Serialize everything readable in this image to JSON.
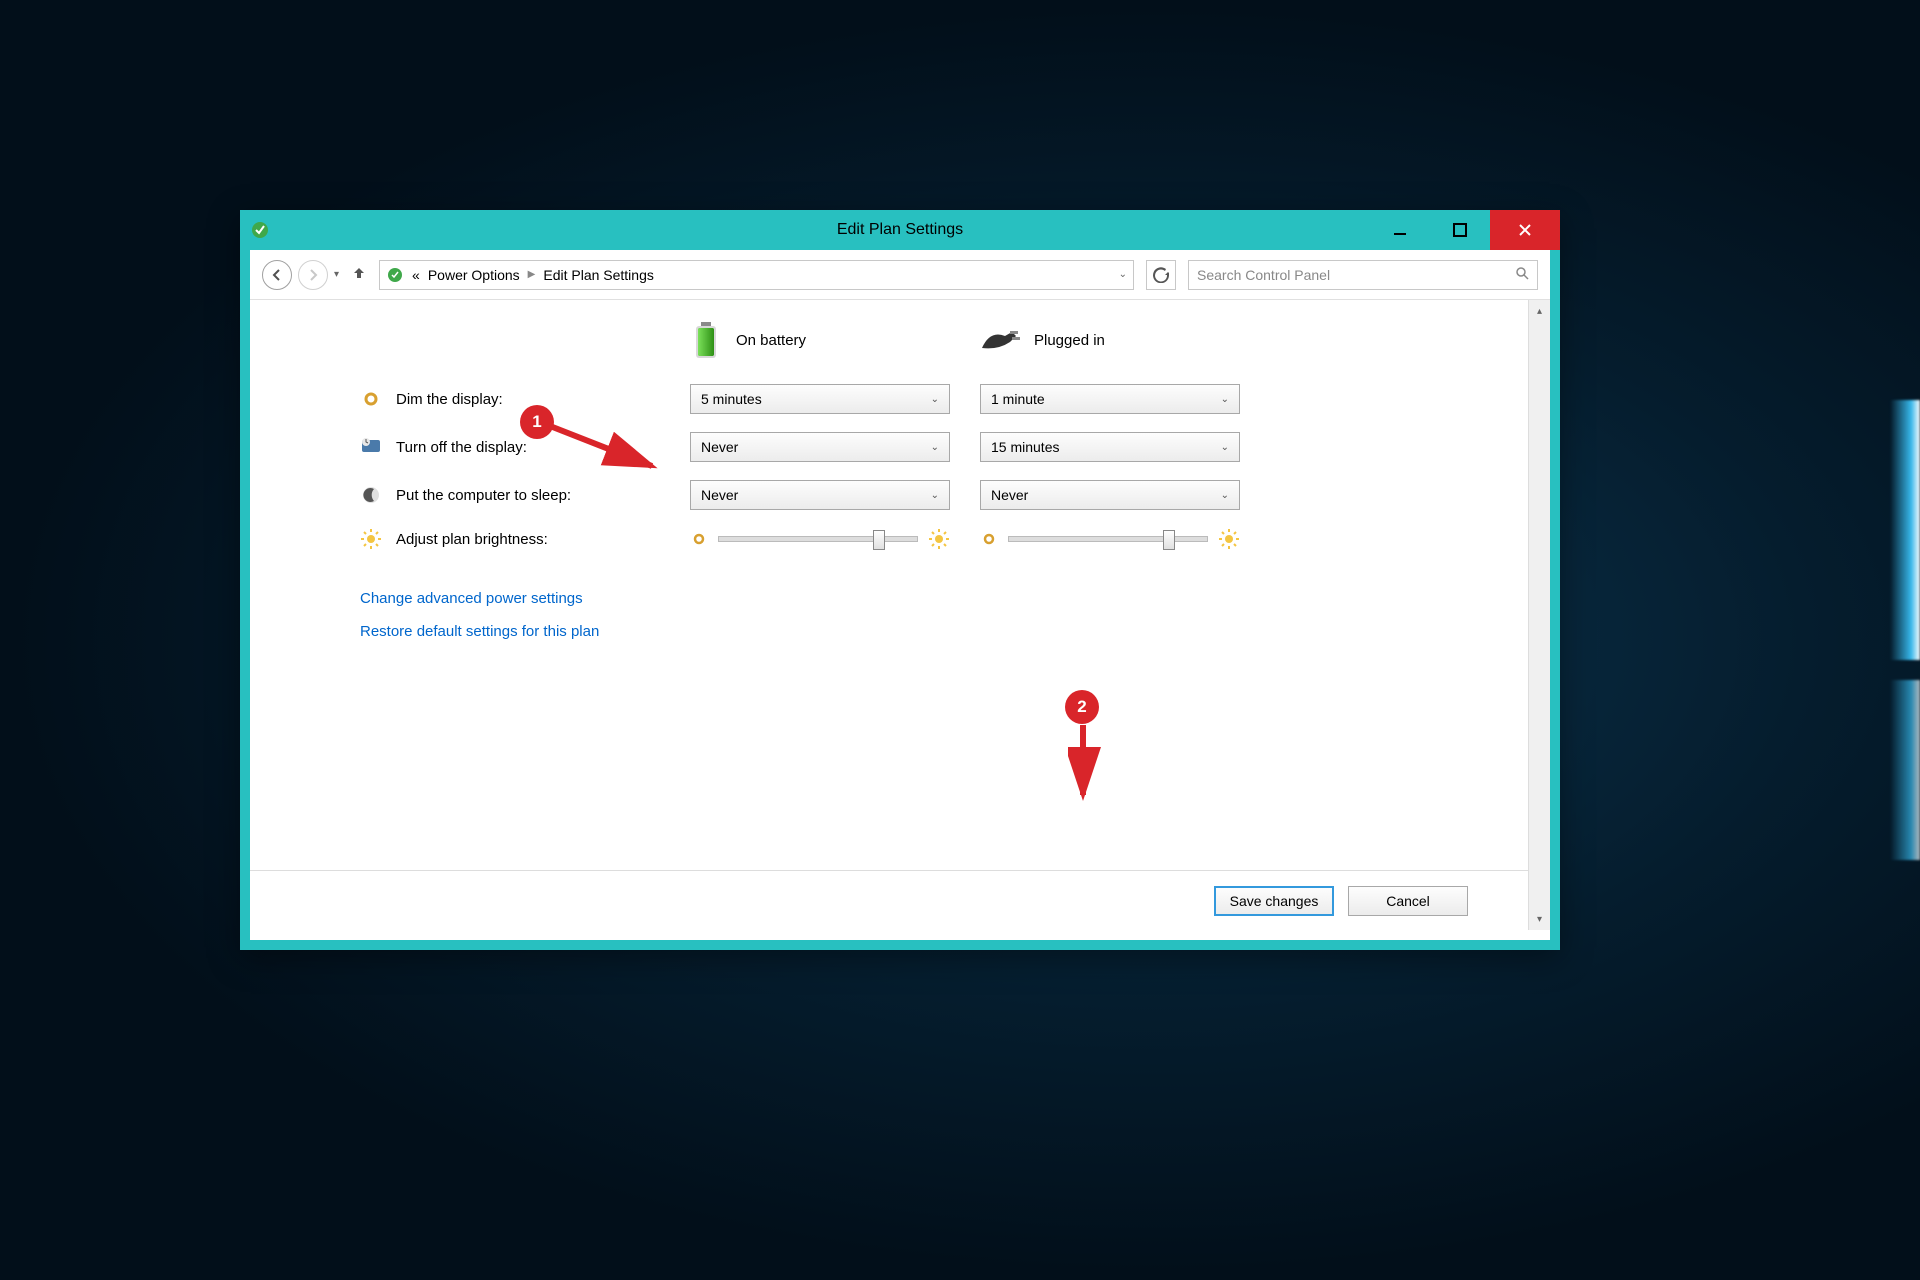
{
  "window": {
    "title": "Edit Plan Settings"
  },
  "breadcrumb": {
    "prefix": "«",
    "items": [
      "Power Options",
      "Edit Plan Settings"
    ]
  },
  "search": {
    "placeholder": "Search Control Panel"
  },
  "columns": {
    "battery": "On battery",
    "plugged": "Plugged in"
  },
  "rows": {
    "dim": {
      "label": "Dim the display:",
      "battery": "5 minutes",
      "plugged": "1 minute"
    },
    "turnoff": {
      "label": "Turn off the display:",
      "battery": "Never",
      "plugged": "15 minutes"
    },
    "sleep": {
      "label": "Put the computer to sleep:",
      "battery": "Never",
      "plugged": "Never"
    },
    "brightness": {
      "label": "Adjust plan brightness:"
    }
  },
  "links": {
    "advanced": "Change advanced power settings",
    "restore": "Restore default settings for this plan"
  },
  "buttons": {
    "save": "Save changes",
    "cancel": "Cancel"
  },
  "annotations": {
    "one": "1",
    "two": "2"
  }
}
